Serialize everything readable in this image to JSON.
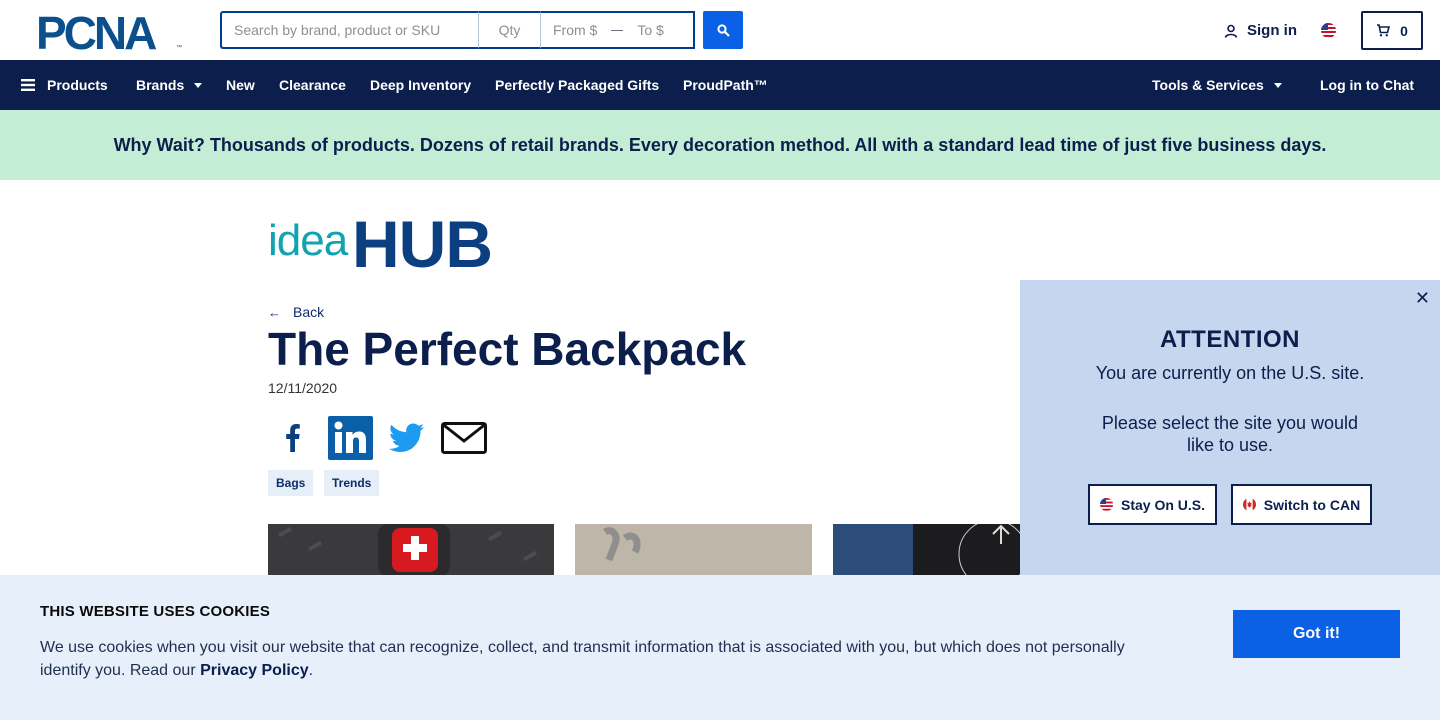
{
  "header": {
    "logo_text": "PCNA",
    "search_placeholder": "Search by brand, product or SKU",
    "qty_placeholder": "Qty",
    "price_from_placeholder": "From $",
    "price_to_placeholder": "To $",
    "sign_in": "Sign in",
    "cart_count": "0"
  },
  "nav": {
    "products": "Products",
    "brands": "Brands",
    "new": "New",
    "clearance": "Clearance",
    "deep_inventory": "Deep Inventory",
    "gifts": "Perfectly Packaged Gifts",
    "proudpath": "ProudPath™",
    "tools": "Tools & Services",
    "chat": "Log in to Chat"
  },
  "promo": "Why Wait? Thousands of products. Dozens of retail brands. Every decoration method. All with a standard lead time of just five business days.",
  "article": {
    "brand_idea": "idea",
    "brand_hub": "HUB",
    "back": "Back",
    "title": "The Perfect Backpack",
    "date": "12/11/2020",
    "tags": [
      "Bags",
      "Trends"
    ]
  },
  "attention": {
    "title": "ATTENTION",
    "message": "You are currently on the U.S. site.",
    "prompt": "Please select the site you would like to use.",
    "stay_label": "Stay On U.S.",
    "switch_label": "Switch to CAN"
  },
  "cookie": {
    "title": "THIS WEBSITE USES COOKIES",
    "text": "We use cookies when you visit our website that can recognize, collect, and transmit information that is associated with you, but which does not personally identify you. Read our",
    "link": "Privacy Policy",
    "suffix": ".",
    "button": "Got it!"
  },
  "colors": {
    "navy": "#0c1f4c",
    "accent_blue": "#0a61e5",
    "promo_green": "#c4edd6",
    "panel_blue": "#c5d6ee",
    "cookie_bg": "#e6effa"
  }
}
